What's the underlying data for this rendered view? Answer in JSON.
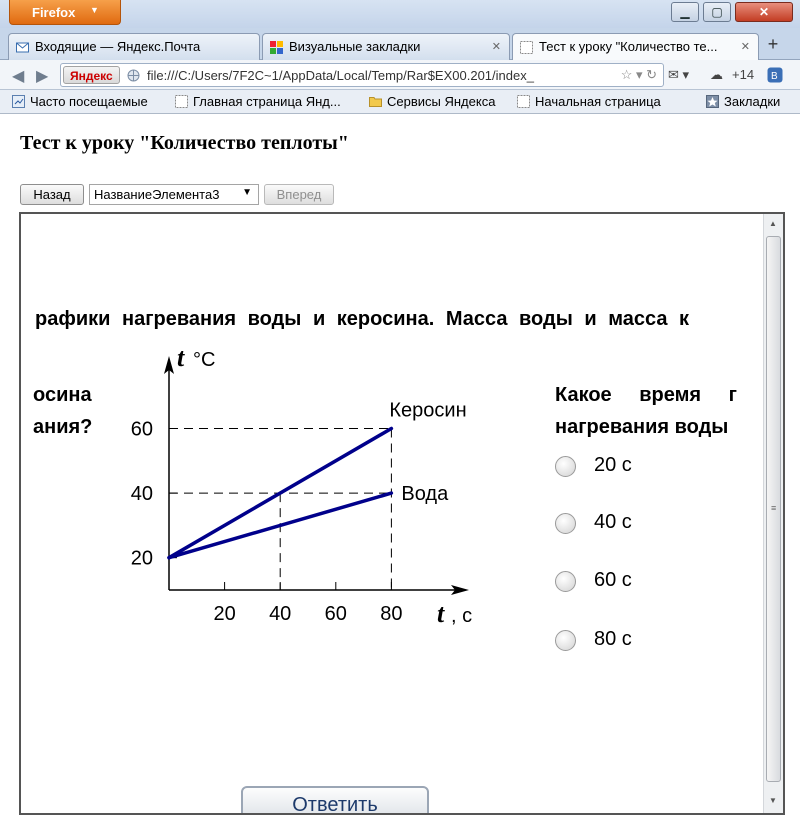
{
  "window": {
    "menu_label": "Firefox",
    "controls": {
      "minimize": "▁",
      "maximize": "▢",
      "close": "✕"
    }
  },
  "tabs": [
    {
      "label": "Входящие — Яндекс.Почта"
    },
    {
      "label": "Визуальные закладки"
    },
    {
      "label": "Тест к уроку \"Количество те...",
      "active": true
    }
  ],
  "navbar": {
    "search_badge": "Яндекс",
    "url": "file:///C:/Users/7F2C~1/AppData/Local/Temp/Rar$EX00.201/index_",
    "cloud_count": "+14"
  },
  "bookmarks": [
    {
      "label": "Часто посещаемые"
    },
    {
      "label": "Главная страница Янд..."
    },
    {
      "label": "Сервисы Яндекса"
    },
    {
      "label": "Начальная страница"
    },
    {
      "label": "Закладки"
    }
  ],
  "page": {
    "title": "Тест к уроку \"Количество теплоты\"",
    "back_label": "Назад",
    "select_value": "НазваниеЭлемента3",
    "next_label": "Вперед",
    "question_line": "рафики нагревания воды и керосина. Масса воды и масса к",
    "left_lines": [
      "осина",
      "ания?"
    ],
    "question_lines": [
      "Какое время г",
      "нагревания воды"
    ],
    "options": [
      "20 с",
      "40 с",
      "60 с",
      "80 с"
    ],
    "answer_label": "Ответить"
  },
  "chart_data": {
    "type": "line",
    "ylabel_symbol": "t",
    "ylabel_unit": "°С",
    "xlabel_symbol": "t",
    "xlabel_unit": ", с",
    "x_ticks": [
      20,
      40,
      60,
      80
    ],
    "y_ticks": [
      20,
      40,
      60
    ],
    "xlim": [
      0,
      100
    ],
    "ylim": [
      10,
      70
    ],
    "series": [
      {
        "name": "Керосин",
        "x": [
          0,
          80
        ],
        "y": [
          20,
          60
        ]
      },
      {
        "name": "Вода",
        "x": [
          0,
          80
        ],
        "y": [
          20,
          40
        ]
      }
    ],
    "guides": [
      {
        "from": [
          0,
          60
        ],
        "to": [
          80,
          60
        ]
      },
      {
        "from": [
          80,
          60
        ],
        "to": [
          80,
          0
        ]
      },
      {
        "from": [
          0,
          40
        ],
        "to": [
          80,
          40
        ]
      },
      {
        "from": [
          40,
          40
        ],
        "to": [
          40,
          0
        ]
      }
    ],
    "line_color": "#00008b",
    "grid": false
  }
}
